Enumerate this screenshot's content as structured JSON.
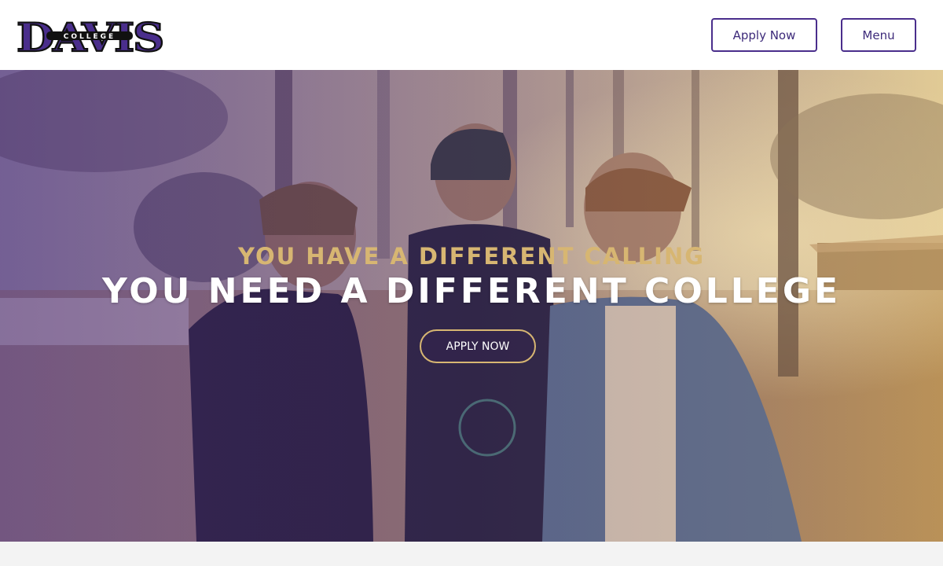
{
  "header": {
    "logo": {
      "wordmark": "DAVIS",
      "sub": "COLLEGE",
      "colors": {
        "fill": "#4a2e8c",
        "outline": "#111111"
      }
    },
    "apply_label": "Apply Now",
    "menu_label": "Menu"
  },
  "hero": {
    "tagline_top": "YOU HAVE A DIFFERENT CALLING",
    "tagline_main": "YOU NEED A DIFFERENT COLLEGE",
    "cta_label": "APPLY NOW",
    "colors": {
      "gold": "#d7b672",
      "white": "#ffffff",
      "purple": "#4a2e8c"
    }
  }
}
